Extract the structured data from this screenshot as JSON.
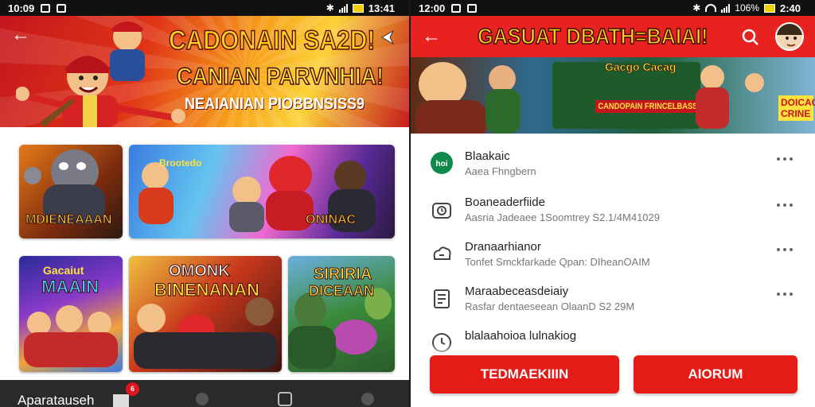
{
  "left": {
    "status": {
      "time": "10:09",
      "time_right": "13:41"
    },
    "hero": {
      "title": "CADONAIN SA2D!",
      "title2": "CANIAN PARVNHIA!",
      "subtitle": "NEAIANIAN PIOBBNSISS9"
    },
    "tiles": [
      {
        "label": "MDIENEAAAN",
        "caption": ""
      },
      {
        "label": "ONINAC",
        "caption": "Brootedo"
      },
      {
        "label": "MAAIN",
        "caption": "Gacaiut"
      },
      {
        "label": "BINENANAN",
        "caption": "OMONK"
      },
      {
        "label": "DICEAAN",
        "caption": "SIRIRIA"
      }
    ],
    "bottom_nav": {
      "label": "Aparatauseh",
      "badge": "6"
    }
  },
  "right": {
    "status": {
      "time": "12:00",
      "battery": "106%",
      "time_right": "2:40"
    },
    "app_title": "GASUAT DBATH=BAIAI!",
    "banner": {
      "text1": "Gacgo Cacag",
      "text2": "CANDOPAIN FRINCELBASS",
      "text3": "DOICAC CRINE"
    },
    "list": [
      {
        "icon": "logo-icon",
        "badge_text": "hoi",
        "title": "Blaakaic",
        "subtitle": "Aaea Fhngbern"
      },
      {
        "icon": "camera-clock-icon",
        "title": "Boaneaderfiide",
        "subtitle": "Aasria Jadeaee 1Soomtrey S2.1/4M41029"
      },
      {
        "icon": "cloud-sync-icon",
        "title": "Dranaarhianor",
        "subtitle": "Tonfet Smckfarkade Qpan: DIheanOAIM"
      },
      {
        "icon": "document-icon",
        "title": "Maraabeceasdeiaiy",
        "subtitle": "Rasfar dentaeseean OlaanD S2 29M"
      },
      {
        "icon": "clock-icon",
        "title": "blalaahoioa lulnakiog",
        "subtitle": ""
      }
    ],
    "buttons": {
      "primary": "TEDMAEKIIIN",
      "secondary": "AIORUM"
    }
  },
  "colors": {
    "accent": "#e41b17",
    "appbar": "#e8231f",
    "title_yellow": "#ffd21a"
  }
}
